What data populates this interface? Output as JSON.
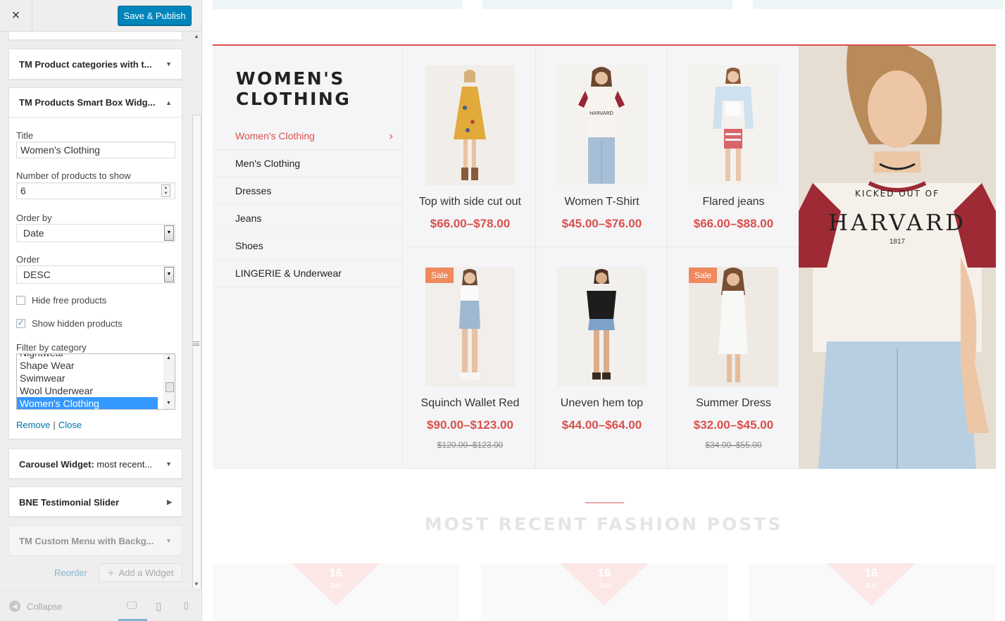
{
  "sidebar": {
    "close_icon": "×",
    "publish_label": "Save & Publish",
    "widgets_above": [
      {
        "title": "TM Product categories with t...",
        "state": "collapsed"
      }
    ],
    "open_widget": {
      "title": "TM Products Smart Box Widg...",
      "fields": {
        "title_label": "Title",
        "title_value": "Women's Clothing",
        "count_label": "Number of products to show",
        "count_value": "6",
        "orderby_label": "Order by",
        "orderby_value": "Date",
        "order_label": "Order",
        "order_value": "DESC",
        "hide_free_label": "Hide free products",
        "hide_free_checked": false,
        "show_hidden_label": "Show hidden products",
        "show_hidden_checked": true,
        "filter_label": "Filter by category",
        "filter_options": [
          "Nightwear",
          "Shape Wear",
          "Swimwear",
          "Wool Underwear",
          "Women's Clothing"
        ],
        "filter_selected": "Women's Clothing"
      },
      "remove_label": "Remove",
      "link_separator": "|",
      "close_label": "Close"
    },
    "widgets_below": [
      {
        "title_bold": "Carousel Widget:",
        "title_rest": " most recent...",
        "caret": "▼"
      },
      {
        "title_bold": "BNE Testimonial Slider",
        "title_rest": "",
        "caret": "▶"
      },
      {
        "title_bold": "TM Custom Menu with Backg...",
        "title_rest": "",
        "caret": "▼"
      }
    ],
    "reorder_label": "Reorder",
    "add_widget_label": "Add a Widget",
    "collapse_label": "Collapse",
    "devices": [
      "desktop-icon",
      "tablet-icon",
      "mobile-icon"
    ]
  },
  "preview": {
    "section_title_line1": "WOMEN'S",
    "section_title_line2": "CLOTHING",
    "categories": [
      {
        "label": "Women's Clothing",
        "active": true
      },
      {
        "label": "Men's Clothing",
        "active": false
      },
      {
        "label": "Dresses",
        "active": false
      },
      {
        "label": "Jeans",
        "active": false
      },
      {
        "label": "Shoes",
        "active": false
      },
      {
        "label": "LINGERIE & Underwear",
        "active": false
      }
    ],
    "products": [
      {
        "name": "Top with side cut out",
        "price": "$66.00–$78.00",
        "old_price": "",
        "sale": ""
      },
      {
        "name": "Women T-Shirt",
        "price": "$45.00–$76.00",
        "old_price": "",
        "sale": ""
      },
      {
        "name": "Flared jeans",
        "price": "$66.00–$88.00",
        "old_price": "",
        "sale": ""
      },
      {
        "name": "Squinch Wallet Red",
        "price": "$90.00–$123.00",
        "old_price": "$120.00–$123.00",
        "sale": "Sale"
      },
      {
        "name": "Uneven hem top",
        "price": "$44.00–$64.00",
        "old_price": "",
        "sale": ""
      },
      {
        "name": "Summer Dress",
        "price": "$32.00–$45.00",
        "old_price": "$34.00–$55.00",
        "sale": "Sale"
      }
    ],
    "hero": {
      "shirt_line1": "KICKED OUT OF",
      "shirt_line2": "HARVARD",
      "shirt_line3": "1817"
    },
    "posts_title": "MOST RECENT FASHION POSTS",
    "post_dates": [
      {
        "day": "16",
        "month": "Jun"
      },
      {
        "day": "16",
        "month": "Jun"
      },
      {
        "day": "16",
        "month": "Jun"
      }
    ]
  },
  "colors": {
    "accent": "#d9504c",
    "publish": "#0085ba",
    "sale_badge": "#ef8a5e",
    "link": "#0073aa"
  }
}
